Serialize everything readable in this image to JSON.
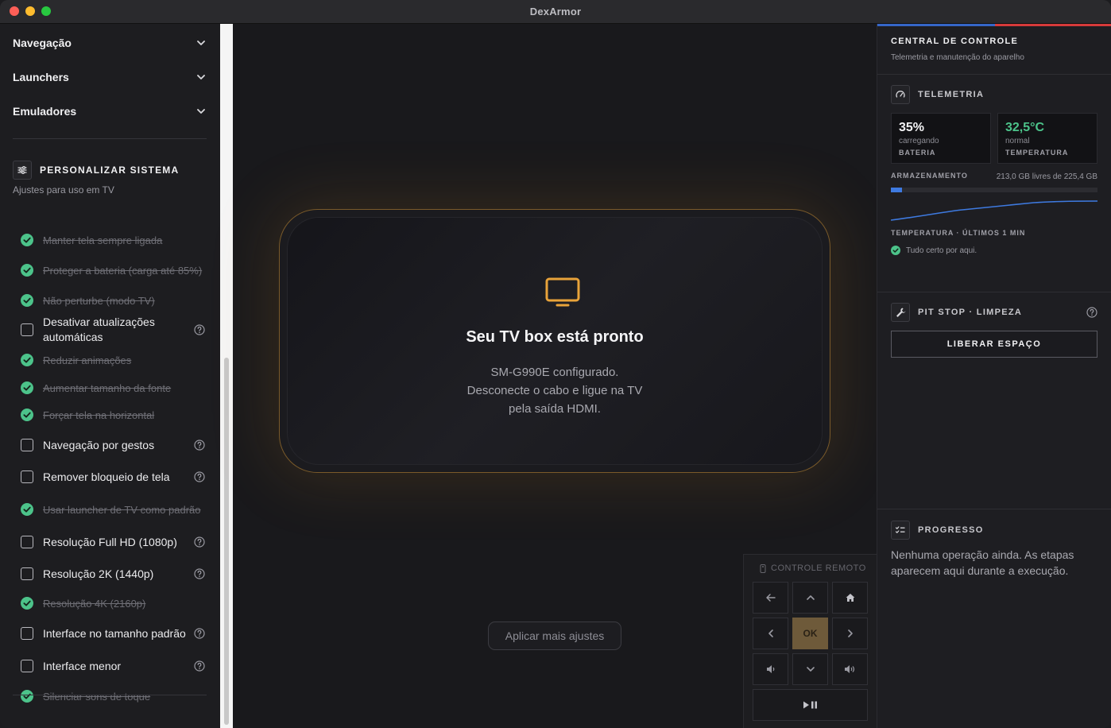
{
  "window": {
    "title": "DexArmor"
  },
  "sidebar": {
    "sections": [
      {
        "label": "Navegação"
      },
      {
        "label": "Launchers"
      },
      {
        "label": "Emuladores"
      }
    ],
    "customize": {
      "title": "PERSONALIZAR SISTEMA",
      "subtitle": "Ajustes para uso em TV",
      "options": [
        {
          "label": "Manter tela sempre ligada",
          "done": true,
          "help": false
        },
        {
          "label": "Proteger a bateria (carga até 85%)",
          "done": true,
          "help": false
        },
        {
          "label": "Não perturbe (modo TV)",
          "done": true,
          "help": false
        },
        {
          "label": "Desativar atualizações automáticas",
          "done": false,
          "help": true
        },
        {
          "label": "Reduzir animações",
          "done": true,
          "help": false
        },
        {
          "label": "Aumentar tamanho da fonte",
          "done": true,
          "help": false
        },
        {
          "label": "Forçar tela na horizontal",
          "done": true,
          "help": false
        },
        {
          "label": "Navegação por gestos",
          "done": false,
          "help": true
        },
        {
          "label": "Remover bloqueio de tela",
          "done": false,
          "help": true
        },
        {
          "label": "Usar launcher de TV como padrão",
          "done": true,
          "help": false
        },
        {
          "label": "Resolução Full HD (1080p)",
          "done": false,
          "help": true
        },
        {
          "label": "Resolução 2K (1440p)",
          "done": false,
          "help": true
        },
        {
          "label": "Resolução 4K (2160p)",
          "done": true,
          "help": false
        },
        {
          "label": "Interface no tamanho padrão",
          "done": false,
          "help": true
        },
        {
          "label": "Interface menor",
          "done": false,
          "help": true
        },
        {
          "label": "Silenciar sons de toque",
          "done": true,
          "help": false
        }
      ]
    }
  },
  "main": {
    "card": {
      "title": "Seu TV box está pronto",
      "line1": "SM-G990E configurado.",
      "line2": "Desconecte o cabo e ligue na TV",
      "line3": "pela saída HDMI."
    },
    "apply_label": "Aplicar mais ajustes",
    "remote": {
      "title": "CONTROLE REMOTO",
      "ok_label": "OK"
    }
  },
  "panel": {
    "title": "CENTRAL DE CONTROLE",
    "subtitle": "Telemetria e manutenção do aparelho",
    "telemetry": {
      "title": "TELEMETRIA",
      "battery": {
        "value": "35%",
        "status": "carregando",
        "label": "BATERIA"
      },
      "temperature": {
        "value": "32,5°C",
        "status": "normal",
        "label": "TEMPERATURA"
      },
      "storage": {
        "label": "ARMAZENAMENTO",
        "value": "213,0 GB livres de 225,4 GB",
        "used_fraction": 0.055
      },
      "temp_chart_label": "TEMPERATURA · ÚLTIMOS 1 MIN",
      "status_ok": "Tudo certo por aqui."
    },
    "pitstop": {
      "title": "PIT STOP · LIMPEZA",
      "button": "LIBERAR ESPAÇO"
    },
    "progress": {
      "title": "PROGRESSO",
      "text": "Nenhuma operação ainda. As etapas aparecem aqui durante a execução."
    }
  },
  "colors": {
    "accent_orange": "#e8a33a",
    "ok_green": "#4cc38a",
    "temp_green": "#4cc38a",
    "storage_blue": "#3e7ae0",
    "flag_blue": "#3566c8",
    "flag_red": "#d63a3a"
  }
}
